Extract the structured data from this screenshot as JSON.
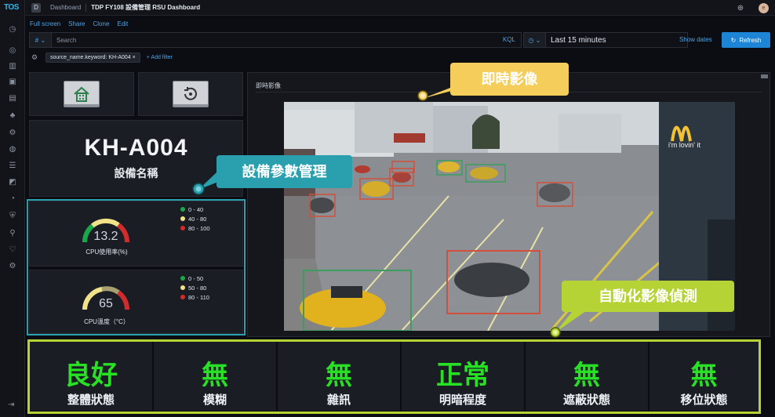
{
  "app": {
    "logo": "TOS",
    "space_initial": "D"
  },
  "breadcrumb": {
    "root": "Dashboard",
    "current": "TDP FY108 設備管理 RSU Dashboard"
  },
  "menu": {
    "full_screen": "Full screen",
    "share": "Share",
    "clone": "Clone",
    "edit": "Edit"
  },
  "query": {
    "type_label": "#",
    "placeholder": "Search",
    "language": "KQL",
    "time_range": "Last 15 minutes",
    "show_dates": "Show dates",
    "refresh_label": "Refresh"
  },
  "filters": [
    {
      "label": "source_name.keyword: KH-A004"
    }
  ],
  "add_filter": "+ Add filter",
  "device": {
    "name": "KH-A004",
    "subtitle": "設備名稱"
  },
  "cpu_usage": {
    "value": "13.2",
    "level": 13.2,
    "label": "CPU使用率(%)",
    "legend": [
      {
        "range": "0 - 40",
        "color": "#18a84a"
      },
      {
        "range": "40 - 80",
        "color": "#f2e28a"
      },
      {
        "range": "80 - 100",
        "color": "#d22b2b"
      }
    ]
  },
  "cpu_temp": {
    "value": "65",
    "level": 65,
    "label": "CPU溫度（°C）",
    "legend": [
      {
        "range": "0 - 50",
        "color": "#18a84a"
      },
      {
        "range": "50 - 80",
        "color": "#f2e28a"
      },
      {
        "range": "80 - 110",
        "color": "#d22b2b"
      }
    ]
  },
  "video": {
    "title": "即時影像",
    "sign_text": "i'm lovin' it"
  },
  "callouts": {
    "realtime": "即時影像",
    "params": "設備參數管理",
    "detection": "自動化影像偵測"
  },
  "status": [
    {
      "value": "良好",
      "label": "整體狀態"
    },
    {
      "value": "無",
      "label": "模糊"
    },
    {
      "value": "無",
      "label": "雜訊"
    },
    {
      "value": "正常",
      "label": "明暗程度"
    },
    {
      "value": "無",
      "label": "遮蔽狀態"
    },
    {
      "value": "無",
      "label": "移位狀態"
    }
  ],
  "colors": {
    "accent": "#1e85d6",
    "status_green": "#28e024",
    "highlight_teal": "#2a9fae",
    "highlight_lime": "#b5d334",
    "callout_yellow": "#f4cd5b"
  }
}
